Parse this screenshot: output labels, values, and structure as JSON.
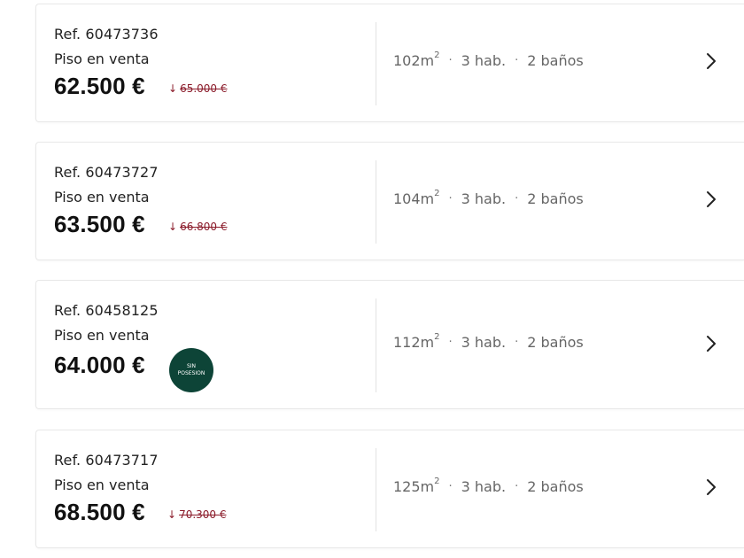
{
  "listings": [
    {
      "ref": "Ref. 60473736",
      "type": "Piso en venta",
      "price": "62.500 €",
      "old_price_arrow": "↓",
      "old_price": "65.000 €",
      "area_value": "102m",
      "area_sup": "2",
      "rooms": "3 hab.",
      "baths": "2 baños"
    },
    {
      "ref": "Ref. 60473727",
      "type": "Piso en venta",
      "price": "63.500 €",
      "old_price_arrow": "↓",
      "old_price": "66.800 €",
      "area_value": "104m",
      "area_sup": "2",
      "rooms": "3 hab.",
      "baths": "2 baños"
    },
    {
      "ref": "Ref. 60458125",
      "type": "Piso en venta",
      "price": "64.000 €",
      "badge_line1": "SIN",
      "badge_line2": "POSESION",
      "area_value": "112m",
      "area_sup": "2",
      "rooms": "3 hab.",
      "baths": "2 baños"
    },
    {
      "ref": "Ref. 60473717",
      "type": "Piso en venta",
      "price": "68.500 €",
      "old_price_arrow": "↓",
      "old_price": "70.300 €",
      "area_value": "125m",
      "area_sup": "2",
      "rooms": "3 hab.",
      "baths": "2 baños"
    }
  ],
  "separator": "·",
  "icons": {
    "open": "chevron-right-icon"
  },
  "colors": {
    "price_drop": "#8b1b2a",
    "badge_bg": "#0d4437",
    "border": "#e8e8e8"
  }
}
